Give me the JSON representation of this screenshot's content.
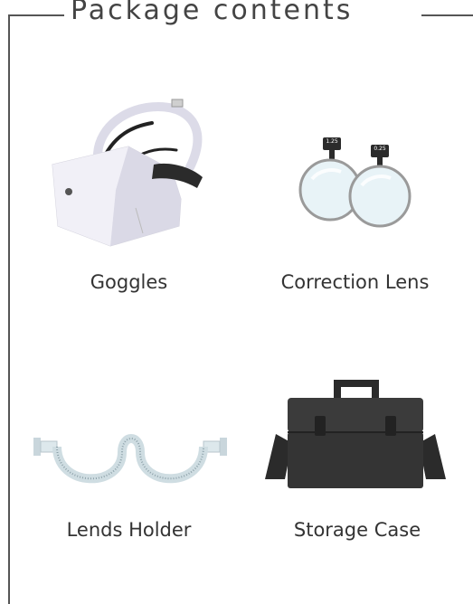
{
  "title": "Package contents",
  "items": [
    {
      "label": "Goggles",
      "icon": "goggles-icon"
    },
    {
      "label": "Correction Lens",
      "icon": "correction-lens-icon",
      "lens_left": "1.25",
      "lens_right": "0.25"
    },
    {
      "label": "Lends Holder",
      "icon": "lens-holder-icon"
    },
    {
      "label": "Storage Case",
      "icon": "storage-case-icon"
    }
  ],
  "colors": {
    "frame": "#555555",
    "case": "#3a3a3a",
    "goggles": "#e9e8f1"
  }
}
